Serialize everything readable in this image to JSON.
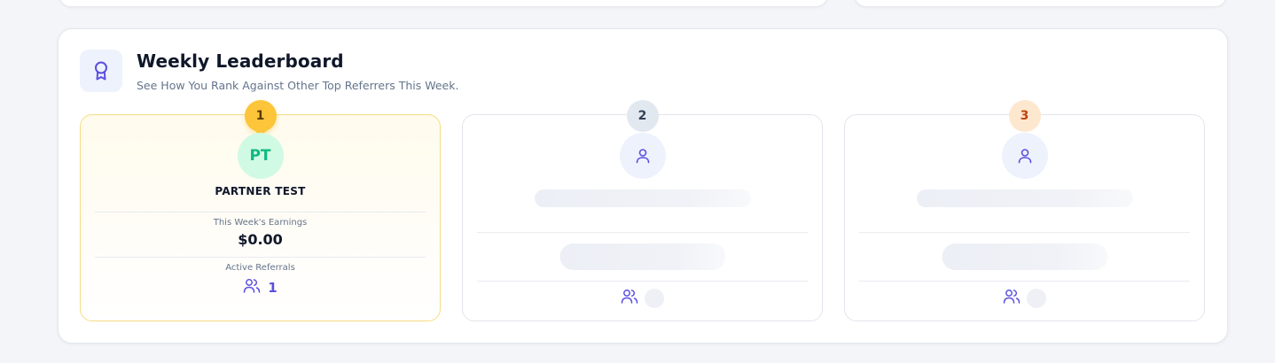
{
  "leaderboard": {
    "title": "Weekly Leaderboard",
    "subtitle": "See How You Rank Against Other Top Referrers This Week.",
    "header_icon": "award-ribbon-icon",
    "entries": [
      {
        "rank": "1",
        "initials": "PT",
        "name": "PARTNER TEST",
        "earnings_label": "This Week's Earnings",
        "earnings": "$0.00",
        "referrals_label": "Active Referrals",
        "referrals": "1",
        "badge_color": "#fcc53a"
      },
      {
        "rank": "2",
        "loading": true,
        "badge_color": "#e2e8f0"
      },
      {
        "rank": "3",
        "loading": true,
        "badge_color": "#fde7cf"
      }
    ]
  },
  "colors": {
    "accent": "#5b4fe0",
    "avatar_green": "#10b981",
    "page_bg": "#f4f5f8"
  }
}
